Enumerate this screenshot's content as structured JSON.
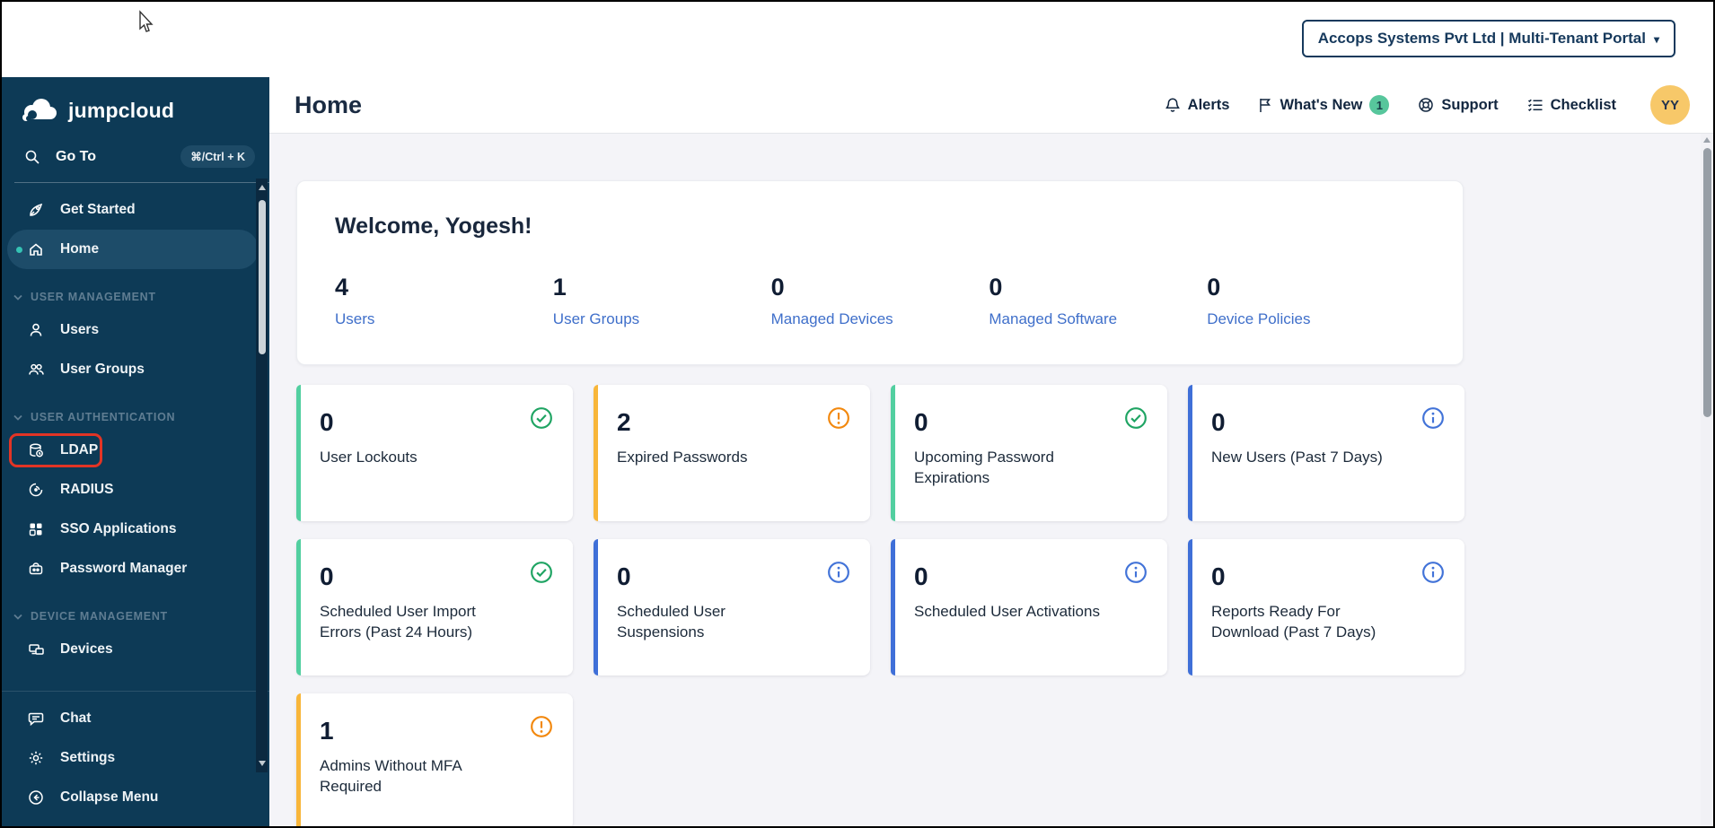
{
  "topbar": {
    "tenant_button_label": "Accops Systems Pvt Ltd | Multi-Tenant Portal",
    "tenant_caret": "▾"
  },
  "sidebar": {
    "logo_text": "jumpcloud",
    "search": {
      "label": "Go To",
      "shortcut": "⌘/Ctrl + K"
    },
    "primary": [
      {
        "label": "Get Started"
      },
      {
        "label": "Home"
      }
    ],
    "sections": [
      {
        "title": "USER MANAGEMENT",
        "items": [
          {
            "label": "Users"
          },
          {
            "label": "User Groups"
          }
        ]
      },
      {
        "title": "USER AUTHENTICATION",
        "items": [
          {
            "label": "LDAP"
          },
          {
            "label": "RADIUS"
          },
          {
            "label": "SSO Applications"
          },
          {
            "label": "Password Manager"
          }
        ]
      },
      {
        "title": "DEVICE MANAGEMENT",
        "items": [
          {
            "label": "Devices"
          }
        ]
      }
    ],
    "footer": [
      {
        "label": "Chat"
      },
      {
        "label": "Settings"
      },
      {
        "label": "Collapse Menu"
      }
    ]
  },
  "header": {
    "title": "Home",
    "actions": {
      "alerts": "Alerts",
      "whats_new": "What's New",
      "whats_new_badge": "1",
      "support": "Support",
      "checklist": "Checklist"
    },
    "avatar_initials": "YY"
  },
  "welcome": {
    "greeting": "Welcome, Yogesh!",
    "stats": [
      {
        "value": "4",
        "label": "Users"
      },
      {
        "value": "1",
        "label": "User Groups"
      },
      {
        "value": "0",
        "label": "Managed Devices"
      },
      {
        "value": "0",
        "label": "Managed Software"
      },
      {
        "value": "0",
        "label": "Device Policies"
      }
    ]
  },
  "cards": [
    {
      "value": "0",
      "label": "User Lockouts",
      "status": "success"
    },
    {
      "value": "2",
      "label": "Expired Passwords",
      "status": "warning"
    },
    {
      "value": "0",
      "label": "Upcoming Password Expirations",
      "status": "success"
    },
    {
      "value": "0",
      "label": "New Users (Past 7 Days)",
      "status": "info"
    },
    {
      "value": "0",
      "label": "Scheduled User Import Errors (Past 24 Hours)",
      "status": "success"
    },
    {
      "value": "0",
      "label": "Scheduled User Suspensions",
      "status": "info"
    },
    {
      "value": "0",
      "label": "Scheduled User Activations",
      "status": "info"
    },
    {
      "value": "0",
      "label": "Reports Ready For Download (Past 7 Days)",
      "status": "info"
    },
    {
      "value": "1",
      "label": "Admins Without MFA Required",
      "status": "warning"
    }
  ],
  "colors": {
    "sidebar_bg": "#0d3a56",
    "accent_teal": "#35c3b4",
    "link_blue": "#3f6fca",
    "success": "#1fa463",
    "warning": "#f2880e",
    "info": "#4273d8",
    "badge_green": "#57c69c",
    "avatar_bg": "#f7c869",
    "annotation_red": "#e23425"
  }
}
